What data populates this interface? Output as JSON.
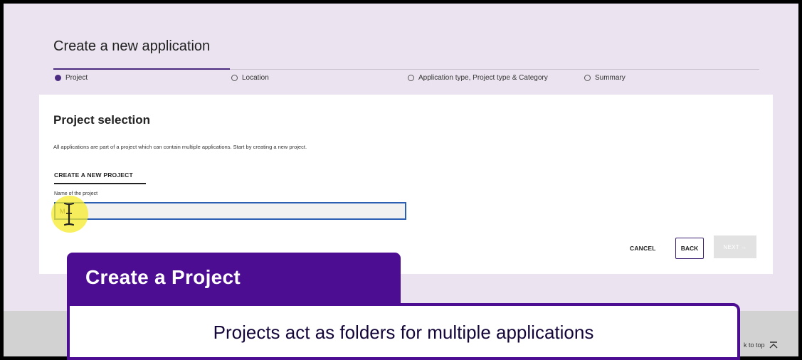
{
  "page": {
    "title": "Create a new application"
  },
  "stepper": {
    "steps": [
      {
        "label": "Project",
        "active": true
      },
      {
        "label": "Location",
        "active": false
      },
      {
        "label": "Application type, Project type & Category",
        "active": false
      },
      {
        "label": "Summary",
        "active": false
      }
    ]
  },
  "card": {
    "title": "Project selection",
    "description": "All applications are part of a project which can contain multiple applications. Start by creating a new project.",
    "section_tab": "CREATE A NEW PROJECT",
    "field_label": "Name of the project",
    "field_value": "M"
  },
  "actions": {
    "cancel_label": "CANCEL",
    "back_label": "BACK",
    "next_label": "NEXT →"
  },
  "footer": {
    "back_to_top_label": "k to top"
  },
  "overlay": {
    "title": "Create a Project",
    "caption": "Projects act as folders for multiple applications"
  },
  "colors": {
    "accent": "#4c0d92",
    "stepper_active": "#4a2b80",
    "input_border": "#2b5fb4",
    "cursor_highlight": "#f5eb28",
    "background": "#ebe4f0"
  },
  "icons": {
    "step_radio": "radio-icon",
    "cursor": "ibeam-cursor-icon",
    "back_to_top": "chevron-up-icon"
  }
}
